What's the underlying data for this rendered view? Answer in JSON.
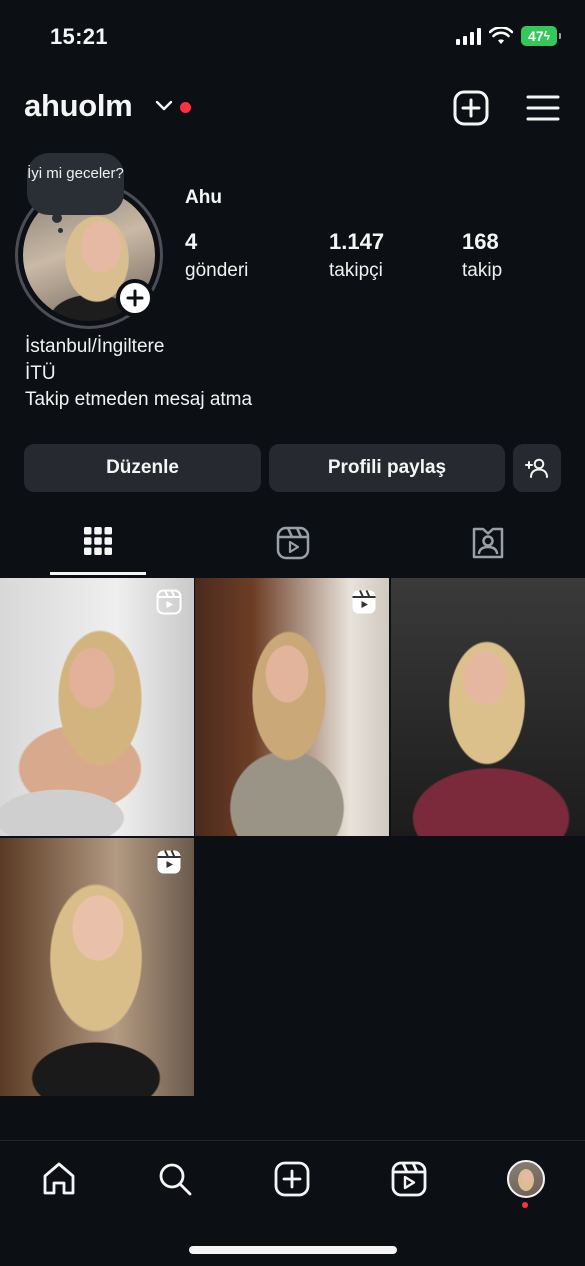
{
  "status_bar": {
    "time": "15:21",
    "battery": "47"
  },
  "header": {
    "username": "ahuolm"
  },
  "profile": {
    "note": "İyi mi geceler?",
    "display_name": "Ahu",
    "stats": [
      {
        "value": "4",
        "label": "gönderi"
      },
      {
        "value": "1.147",
        "label": "takipçi"
      },
      {
        "value": "168",
        "label": "takip"
      }
    ],
    "bio": [
      "İstanbul/İngiltere",
      "İTÜ",
      "Takip etmeden mesaj atma"
    ]
  },
  "buttons": {
    "edit": "Düzenle",
    "share": "Profili paylaş"
  },
  "tabs": [
    {
      "icon": "grid-icon",
      "active": true
    },
    {
      "icon": "reels-icon",
      "active": false
    },
    {
      "icon": "tagged-icon",
      "active": false
    }
  ],
  "posts": [
    {
      "type": "reel"
    },
    {
      "type": "reel"
    },
    {
      "type": "photo"
    },
    {
      "type": "reel"
    }
  ],
  "bottom_nav": [
    "home-icon",
    "search-icon",
    "create-icon",
    "reels-icon",
    "profile-avatar"
  ],
  "colors": {
    "background": "#0c1014",
    "button": "#262a30",
    "notification": "#ff3040",
    "battery": "#34c759"
  }
}
